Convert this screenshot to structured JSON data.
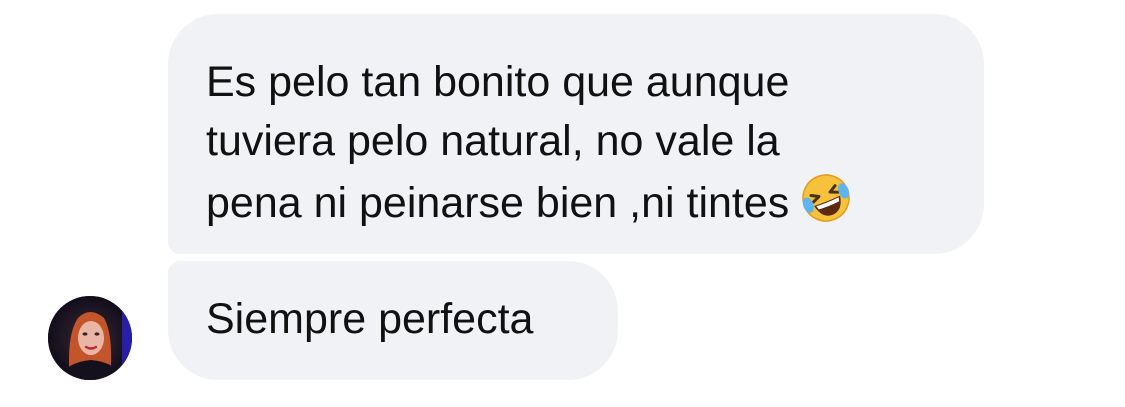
{
  "conversation": {
    "messages": [
      {
        "lines": [
          "Es pelo tan bonito que aunque",
          "tuviera pelo natural, no vale la",
          "pena ni peinarse bien ,ni tintes"
        ],
        "emoji": "rolling-on-the-floor-laughing-icon"
      },
      {
        "lines": [
          "Siempre perfecta"
        ]
      }
    ],
    "sender_avatar": "avatar-photo"
  },
  "colors": {
    "bubble_background": "#f1f2f5",
    "text": "#111111",
    "page_background": "#ffffff"
  }
}
